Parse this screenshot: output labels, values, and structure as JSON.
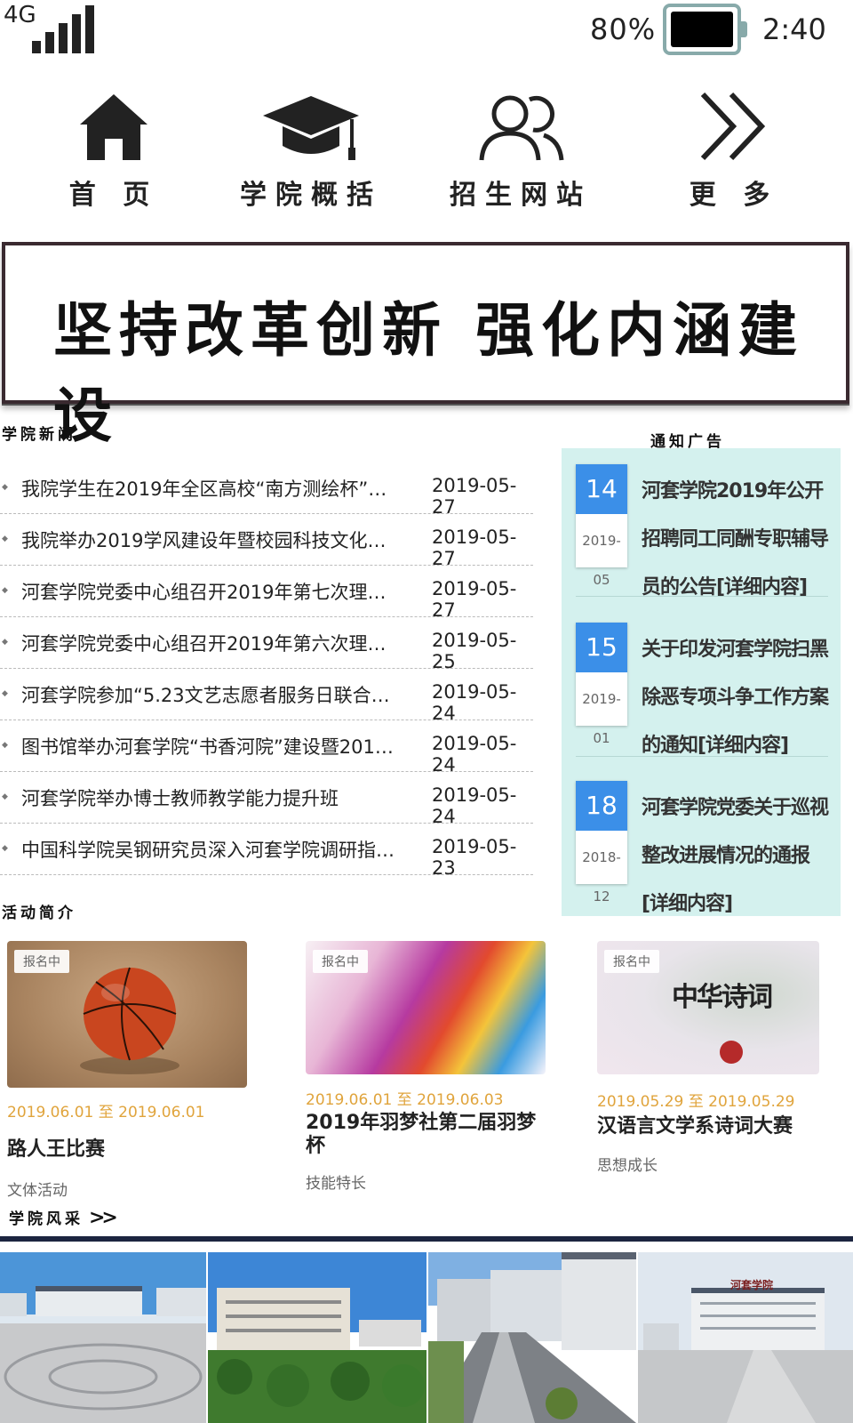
{
  "status_bar": {
    "network": "4G",
    "battery": "80%",
    "time": "2:40"
  },
  "nav": [
    {
      "label": "首 页",
      "icon": "home-icon"
    },
    {
      "label": "学院概括",
      "icon": "graduation-cap-icon"
    },
    {
      "label": "招生网站",
      "icon": "users-icon"
    },
    {
      "label": "更 多",
      "icon": "double-chevron-right-icon"
    }
  ],
  "banner": {
    "text": "坚持改革创新 强化内涵建设"
  },
  "news": {
    "heading": "学院新闻",
    "items": [
      {
        "title": "我院学生在2019年全区高校“南方测绘杯”大...",
        "date": "2019-05-27"
      },
      {
        "title": "我院举办2019学风建设年暨校园科技文化艺术...",
        "date": "2019-05-27"
      },
      {
        "title": "河套学院党委中心组召开2019年第七次理论学...",
        "date": "2019-05-27"
      },
      {
        "title": "河套学院党委中心组召开2019年第六次理论学...",
        "date": "2019-05-25"
      },
      {
        "title": "河套学院参加“5.23文艺志愿者服务日联合赠...",
        "date": "2019-05-24"
      },
      {
        "title": "图书馆举办河套学院“书香河院”建设暨2019...",
        "date": "2019-05-24"
      },
      {
        "title": "河套学院举办博士教师教学能力提升班",
        "date": "2019-05-24"
      },
      {
        "title": "中国科学院吴钢研究员深入河套学院调研指导...",
        "date": "2019-05-23"
      }
    ]
  },
  "notices": {
    "heading": "通知广告",
    "items": [
      {
        "day": "14",
        "month": "2019-05",
        "text": "河套学院2019年公开招聘同工同酬专职辅导员的公告[详细内容]"
      },
      {
        "day": "15",
        "month": "2019-01",
        "text": "关于印发河套学院扫黑除恶专项斗争工作方案的通知[详细内容]"
      },
      {
        "day": "18",
        "month": "2018-12",
        "text": "河套学院党委关于巡视整改进展情况的通报[详细内容]"
      }
    ]
  },
  "activities": {
    "heading": "活动简介",
    "items": [
      {
        "tag": "报名中",
        "range": "2019.06.01 至 2019.06.01",
        "name": "路人王比赛",
        "category": "文体活动"
      },
      {
        "tag": "报名中",
        "range": "2019.06.01 至 2019.06.03",
        "name": "2019年羽梦社第二届羽梦杯",
        "category": "技能特长"
      },
      {
        "tag": "报名中",
        "range": "2019.05.29 至 2019.05.29",
        "name": "汉语言文学系诗词大赛",
        "category": "思想成长"
      }
    ],
    "poster_text": "中华诗词"
  },
  "campus": {
    "link_label": "学院风采",
    "arrow": ">>",
    "sign_text": "河套学院"
  },
  "colors": {
    "notice_bg": "#d4f1ee",
    "notice_day": "#3b8fe8",
    "activity_date": "#e0a43c"
  }
}
